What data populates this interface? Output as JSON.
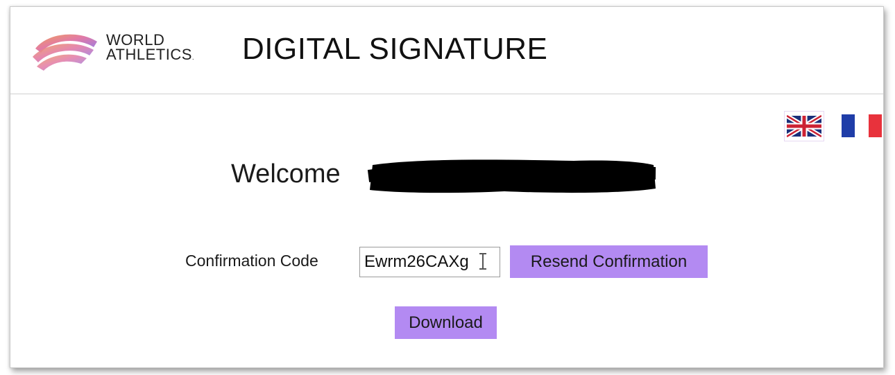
{
  "header": {
    "brand_line1": "WORLD",
    "brand_line2": "ATHLETICS",
    "brand_reg": ".",
    "title": "DIGITAL SIGNATURE"
  },
  "languages": [
    {
      "code": "en",
      "icon": "uk-flag-icon"
    },
    {
      "code": "fr",
      "icon": "france-flag-icon"
    }
  ],
  "welcome": {
    "label": "Welcome"
  },
  "form": {
    "code_label": "Confirmation Code",
    "code_value": "Ewrm26CAXg",
    "resend_label": "Resend Confirmation",
    "download_label": "Download"
  },
  "colors": {
    "accent": "#b38af2",
    "title": "#111111"
  }
}
